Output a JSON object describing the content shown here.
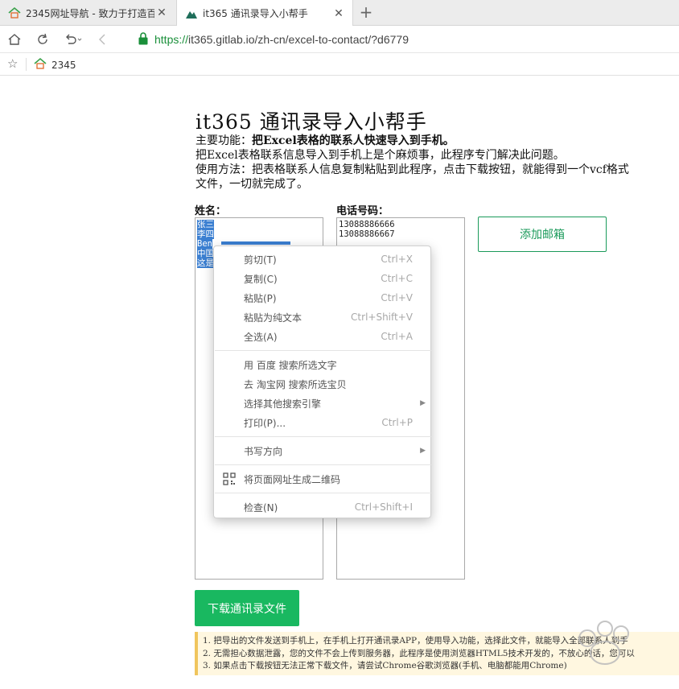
{
  "browser": {
    "tabs": [
      {
        "title": "2345网址导航 - 致力于打造百",
        "active": false,
        "favicon": "house-icon"
      },
      {
        "title": "it365 通讯录导入小帮手",
        "active": true,
        "favicon": "gitlab-mountain-icon"
      }
    ],
    "new_tab_label": "+",
    "close_label": "✕",
    "url_scheme": "https://",
    "url_rest": "it365.gitlab.io/zh-cn/excel-to-contact/?d6779",
    "bookmark_label": "2345"
  },
  "page": {
    "title": "it365 通讯录导入小帮手",
    "feature_prefix": "主要功能：",
    "feature_bold": "把Excel表格的联系人快速导入到手机。",
    "line2": "把Excel表格联系信息导入到手机上是个麻烦事，此程序专门解决此问题。",
    "line3": "使用方法：把表格联系人信息复制粘贴到此程序，点击下载按钮，就能得到一个vcf格式",
    "line4": "文件，一切就完成了。",
    "name_header": "姓名：",
    "phone_header": "电话号码：",
    "names": [
      "张三",
      "李四",
      "Ben",
      "中国",
      "这是"
    ],
    "phones": [
      "13088886666",
      "13088886667"
    ],
    "add_email_button": "添加邮箱",
    "download_button": "下载通讯录文件",
    "notes": [
      "1. 把导出的文件发送到手机上，在手机上打开通讯录APP，使用导入功能，选择此文件，就能导入全部联系人到手",
      "2. 无需担心数据泄露，您的文件不会上传到服务器，此程序是使用浏览器HTML5技术开发的，不放心的话，您可以",
      "3. 如果点击下载按钮无法正常下载文件，请尝试Chrome谷歌浏览器(手机、电脑都能用Chrome)"
    ]
  },
  "context_menu": {
    "items": [
      {
        "label": "剪切(T)",
        "shortcut": "Ctrl+X"
      },
      {
        "label": "复制(C)",
        "shortcut": "Ctrl+C"
      },
      {
        "label": "粘贴(P)",
        "shortcut": "Ctrl+V"
      },
      {
        "label": "粘贴为纯文本",
        "shortcut": "Ctrl+Shift+V"
      },
      {
        "label": "全选(A)",
        "shortcut": "Ctrl+A"
      },
      {
        "label": "用 百度 搜索所选文字",
        "shortcut": ""
      },
      {
        "label": "去 淘宝网 搜索所选宝贝",
        "shortcut": ""
      },
      {
        "label": "选择其他搜索引擎",
        "shortcut": ""
      },
      {
        "label": "打印(P)...",
        "shortcut": "Ctrl+P"
      },
      {
        "label": "书写方向",
        "shortcut": ""
      },
      {
        "label": "将页面网址生成二维码",
        "shortcut": ""
      },
      {
        "label": "检查(N)",
        "shortcut": "Ctrl+Shift+I"
      }
    ],
    "submenu_arrow": "▶"
  },
  "colors": {
    "accent_green": "#19b860",
    "link_green": "#1a9a5a",
    "selection_blue": "#3b7fd1",
    "note_border": "#f0c55d"
  }
}
